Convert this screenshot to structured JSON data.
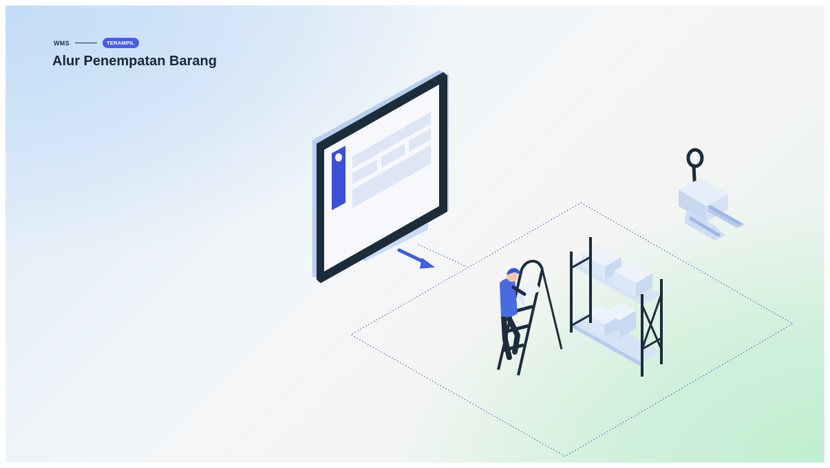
{
  "header": {
    "eyebrow": "WMS",
    "badge": "TERAMPIL",
    "title": "Alur Penempatan Barang"
  },
  "theme": {
    "accent": "#4a5be8",
    "title_color": "#1b2538",
    "monitor_frame": "#1c2c3a",
    "worker_shirt": "#4a6be0"
  },
  "illustration": {
    "icons": [
      "monitor-icon",
      "arrow-icon",
      "worker-on-ladder-icon",
      "storage-shelf-icon",
      "pallet-jack-icon",
      "floor-zone-outline"
    ]
  }
}
